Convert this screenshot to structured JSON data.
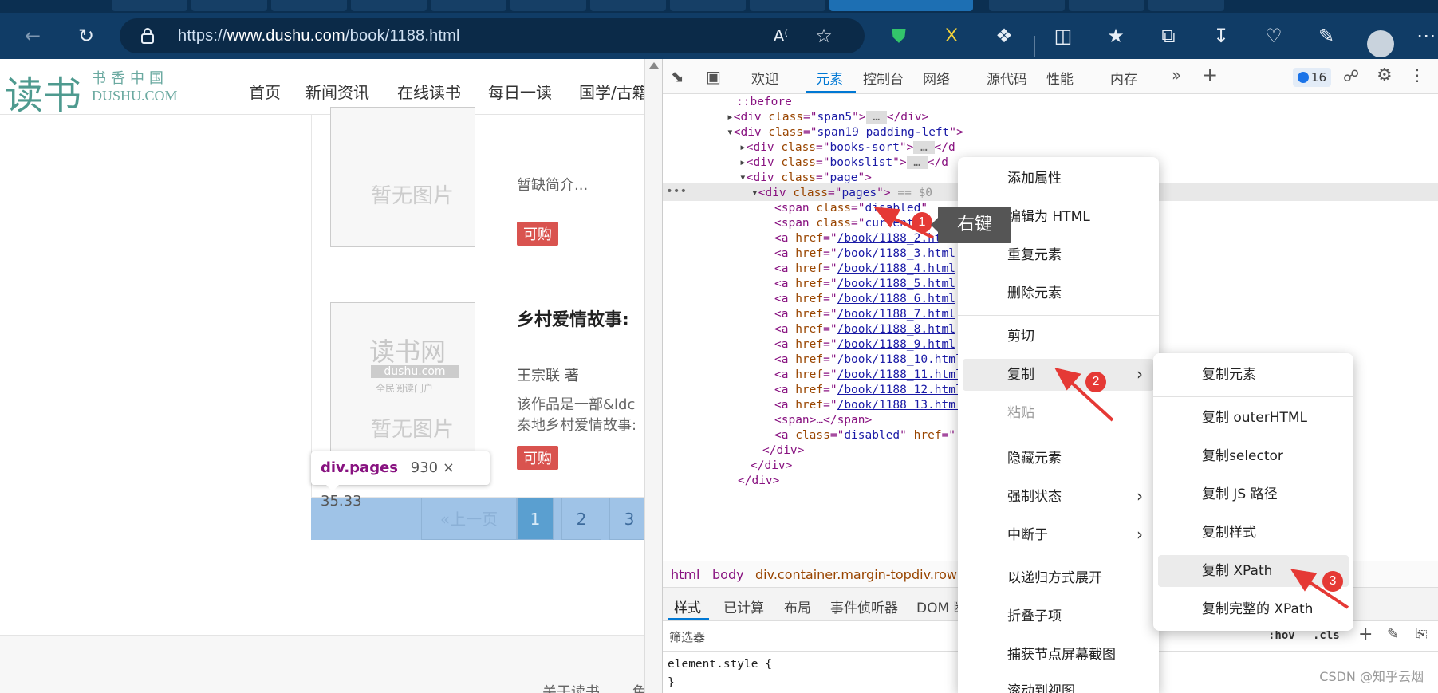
{
  "browser": {
    "url_prefix": "https://",
    "url_domain": "www.dushu.com",
    "url_path": "/book/1188.html"
  },
  "site": {
    "logo_main": "读书",
    "logo_sub": "书香中国",
    "logo_domain": "DUSHU.COM",
    "nav": [
      "首页",
      "新闻资讯",
      "在线读书",
      "每日一读",
      "国学/古籍"
    ]
  },
  "books": [
    {
      "title": "",
      "intro": "暂缺简介...",
      "buy": "可购",
      "cover_text": "暂无图片"
    },
    {
      "title": "乡村爱情故事:",
      "author": "王宗联 著",
      "intro_line1": "该作品是一部&ldc",
      "intro_line2": "秦地乡村爱情故事:",
      "buy": "可购",
      "cover_brand": "读书网",
      "cover_domain": "dushu.com",
      "cover_slogan": "全民阅读门户",
      "cover_text": "暂无图片"
    }
  ],
  "pagination": {
    "prev": "«上一页",
    "pages": [
      "1",
      "2",
      "3"
    ]
  },
  "tooltip": {
    "element": "div.pages",
    "size": "930 × 35.33"
  },
  "footer": {
    "link1": "关于读书",
    "link2": "免"
  },
  "devtools": {
    "tabs": [
      "欢迎",
      "元素",
      "控制台",
      "网络",
      "源代码",
      "性能",
      "内存"
    ],
    "active_tab": "元素",
    "issues_count": "16",
    "dom": [
      "::before",
      "span5",
      "span19 padding-left",
      "books-sort",
      "bookslist",
      "page",
      "pages",
      "disabled",
      "current",
      "/book/1188_2.html",
      "/book/1188_3.html",
      "/book/1188_4.html",
      "/book/1188_5.html",
      "/book/1188_6.html",
      "/book/1188_7.html",
      "/book/1188_8.html",
      "/book/1188_9.html",
      "/book/1188_10.html",
      "/book/1188_11.html",
      "/book/1188_12.html",
      "/book/1188_13.html"
    ],
    "breadcrumb": [
      "html",
      "body",
      "div.container.margin-top",
      "div.row"
    ],
    "subtabs": [
      "样式",
      "已计算",
      "布局",
      "事件侦听器",
      "DOM 断"
    ],
    "filter_placeholder": "筛选器",
    "hov": ":hov",
    "cls": ".cls",
    "style_rule": "element.style {",
    "style_close": "}"
  },
  "context_menu": {
    "items": [
      "添加属性",
      "编辑为 HTML",
      "重复元素",
      "删除元素",
      "剪切",
      "复制",
      "粘贴",
      "隐藏元素",
      "强制状态",
      "中断于",
      "以递归方式展开",
      "折叠子项",
      "捕获节点屏幕截图",
      "滚动到视图"
    ]
  },
  "copy_submenu": {
    "items": [
      "复制元素",
      "复制 outerHTML",
      "复制selector",
      "复制 JS 路径",
      "复制样式",
      "复制 XPath",
      "复制完整的 XPath"
    ]
  },
  "annotations": {
    "step1": "1",
    "step1_label": "右键",
    "step2": "2",
    "step3": "3"
  },
  "watermark": "CSDN @知乎云烟",
  "colors": {
    "accent": "#0078d4",
    "browser_bar": "#103c66",
    "annotation": "#e53935",
    "highlight": "#9fc3e7"
  }
}
